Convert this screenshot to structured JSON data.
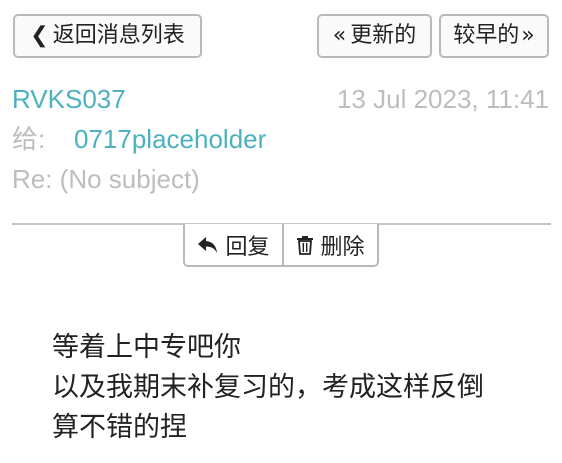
{
  "nav": {
    "back_label": "返回消息列表",
    "newer_label": "更新的",
    "older_label": "较早的"
  },
  "message": {
    "sender": "RVKS037",
    "timestamp": "13 Jul 2023, 11:41",
    "to_label": "给:",
    "to_value": "0717placeholder",
    "subject": "Re: (No subject)",
    "body_lines": [
      "等着上中专吧你",
      "以及我期末补复习的，考成这样反倒",
      "算不错的捏"
    ]
  },
  "actions": {
    "reply_label": "回复",
    "delete_label": "删除"
  },
  "icons": {
    "back": "chevron-left-icon",
    "newer": "double-chevron-left-icon",
    "older": "double-chevron-right-icon",
    "reply": "reply-arrow-icon",
    "delete": "trash-icon"
  },
  "colors": {
    "accent": "#4db1c0",
    "muted_text": "#bdbdbd",
    "border": "#b9b9b9"
  }
}
